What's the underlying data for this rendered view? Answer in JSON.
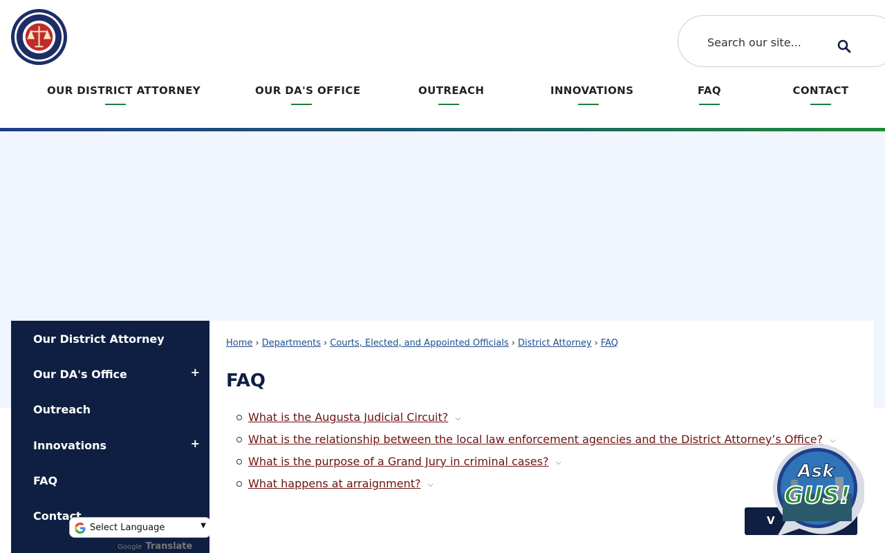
{
  "header": {
    "logo_alt_text": "District Attorney's Office Jared T. Williams Augusta Judicial Circuit Integrity Fairness Justice",
    "search": {
      "placeholder": "Search our site..."
    }
  },
  "nav": [
    {
      "label": "OUR DISTRICT ATTORNEY"
    },
    {
      "label": "OUR DA'S OFFICE"
    },
    {
      "label": "OUTREACH"
    },
    {
      "label": "INNOVATIONS"
    },
    {
      "label": "FAQ"
    },
    {
      "label": "CONTACT"
    }
  ],
  "sidebar": {
    "items": [
      {
        "label": "Our District Attorney",
        "expandable": false
      },
      {
        "label": "Our DA's Office",
        "expandable": true,
        "toggle": "+"
      },
      {
        "label": "Outreach",
        "expandable": false
      },
      {
        "label": "Innovations",
        "expandable": true,
        "toggle": "+"
      },
      {
        "label": "FAQ",
        "expandable": false
      },
      {
        "label": "Contact",
        "expandable": false
      }
    ]
  },
  "translate": {
    "select_label": "Select Language",
    "powered_by": "Google",
    "translate_word": "Translate"
  },
  "breadcrumb": {
    "items": [
      "Home",
      "Departments",
      "Courts, Elected, and Appointed Officials",
      "District Attorney",
      "FAQ"
    ],
    "separator": "›"
  },
  "content": {
    "title": "FAQ",
    "questions": [
      "What is the Augusta Judicial Circuit?",
      "What is the relationship between the local law enforcement agencies and the District Attorney’s Office?",
      "What is the purpose of a Grand Jury in criminal cases?",
      "What happens at arraignment?"
    ],
    "view_all_label": "V"
  },
  "chat_widget": {
    "line1": "Ask",
    "line2": "GUS!"
  },
  "colors": {
    "navy": "#0f1f42",
    "nav_underline_green": "#1e7d3a",
    "link_maroon": "#6b1111",
    "breadcrumb_link_blue": "#1f4d8c",
    "banner_bg": "#f1f5fd"
  },
  "icons": [
    "search-icon",
    "plus-icon",
    "chevron-down-icon",
    "google-g-icon",
    "select-caret-icon"
  ]
}
